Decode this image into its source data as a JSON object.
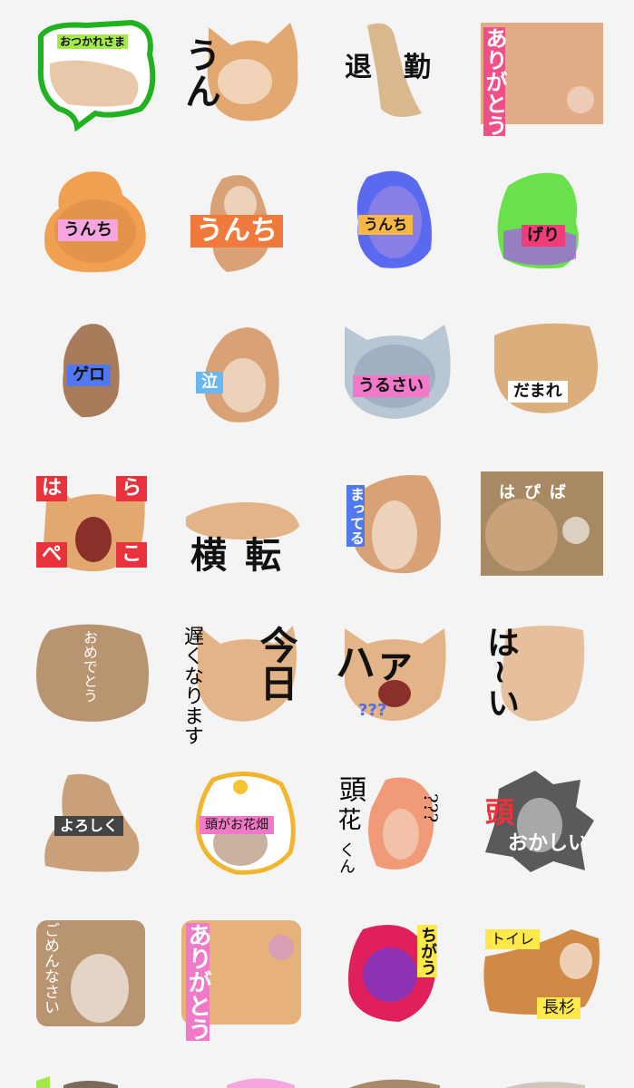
{
  "stickers": [
    {
      "texts": [
        "おつかれさま"
      ]
    },
    {
      "texts": [
        "うん"
      ]
    },
    {
      "texts": [
        "退",
        "勤"
      ]
    },
    {
      "texts": [
        "ありがとう"
      ]
    },
    {
      "texts": [
        "うんち"
      ]
    },
    {
      "texts": [
        "うんち"
      ]
    },
    {
      "texts": [
        "うんち"
      ]
    },
    {
      "texts": [
        "げり"
      ]
    },
    {
      "texts": [
        "ゲロ"
      ]
    },
    {
      "texts": [
        "泣"
      ]
    },
    {
      "texts": [
        "うるさい"
      ]
    },
    {
      "texts": [
        "だまれ"
      ]
    },
    {
      "texts": [
        "は",
        "ら",
        "ぺ",
        "こ"
      ]
    },
    {
      "texts": [
        "横",
        "転"
      ]
    },
    {
      "texts": [
        "まってる"
      ]
    },
    {
      "texts": [
        "はぴば"
      ]
    },
    {
      "texts": [
        "おめでとう"
      ]
    },
    {
      "texts": [
        "遅くなります",
        "今日"
      ]
    },
    {
      "texts": [
        "ハァ",
        "???"
      ]
    },
    {
      "texts": [
        "は~い"
      ]
    },
    {
      "texts": [
        "よろしく"
      ]
    },
    {
      "texts": [
        "頭がお花畑"
      ]
    },
    {
      "texts": [
        "頭",
        "花",
        "くん",
        "???"
      ]
    },
    {
      "texts": [
        "頭",
        "おかしい"
      ]
    },
    {
      "texts": [
        "ごめんなさい"
      ]
    },
    {
      "texts": [
        "ありがとう"
      ]
    },
    {
      "texts": [
        "ちがう"
      ]
    },
    {
      "texts": [
        "トイレ",
        "長杉"
      ]
    }
  ],
  "colors": {
    "background": "#f4f4f4",
    "orange_cat": "#d99a5c",
    "pink_tag": "#f07ac8",
    "orange_tag": "#f07a3c",
    "blue_tag": "#4f6ef0",
    "red_tag": "#e8323c",
    "yellow_tag": "#ffe94a",
    "green_outline": "#21b21f"
  }
}
